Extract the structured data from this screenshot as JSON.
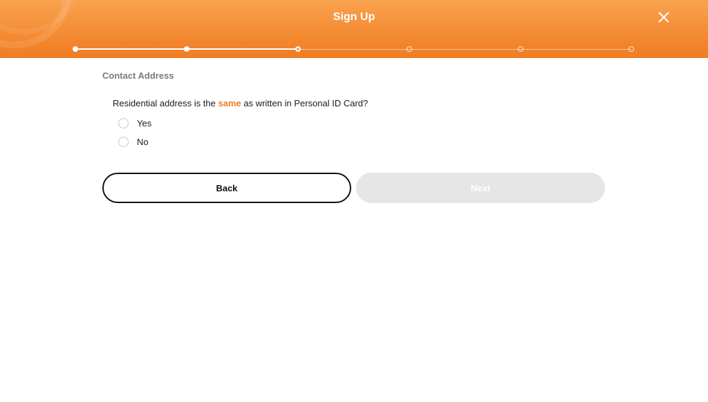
{
  "header": {
    "title": "Sign Up",
    "close_icon": "close-icon",
    "color_top": "#f9a24e",
    "color_bottom": "#f07c22"
  },
  "stepper": {
    "total_steps": 6,
    "current_step": 3
  },
  "form": {
    "section_title": "Contact Address",
    "question_prefix": "Residential address is the ",
    "question_highlight": "same",
    "question_suffix": " as written in Personal ID Card?",
    "options": [
      {
        "label": "Yes",
        "selected": false
      },
      {
        "label": "No",
        "selected": false
      }
    ]
  },
  "actions": {
    "back_label": "Back",
    "next_label": "Next",
    "next_disabled": true
  }
}
